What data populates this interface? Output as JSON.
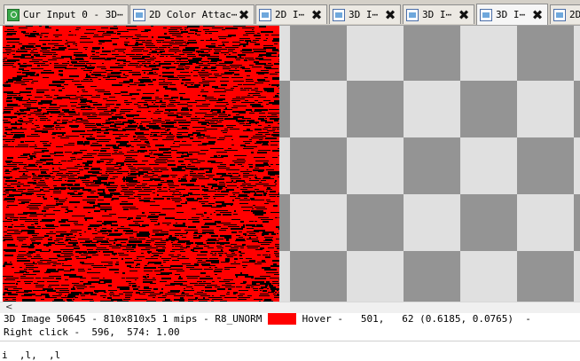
{
  "tabs": [
    {
      "label": "Cur Input 0 - 3D⋯",
      "icon": "texture-viewer-icon",
      "closable": false,
      "active": false
    },
    {
      "label": "2D Color Attac⋯",
      "icon": "document-icon",
      "closable": true,
      "active": false
    },
    {
      "label": "2D I⋯",
      "icon": "document-icon",
      "closable": true,
      "active": false
    },
    {
      "label": "3D I⋯",
      "icon": "document-icon",
      "closable": true,
      "active": false
    },
    {
      "label": "3D I⋯",
      "icon": "document-icon",
      "closable": true,
      "active": false
    },
    {
      "label": "3D I⋯",
      "icon": "document-icon",
      "closable": true,
      "active": true
    },
    {
      "label": "2D",
      "icon": "document-icon",
      "closable": false,
      "active": false
    }
  ],
  "close_glyph": "✖",
  "status": {
    "line1_prefix": "3D Image 50645 - 810x810x5 1 mips - R8_UNORM ",
    "swatch_color": "#ff0000",
    "line1_suffix": " Hover -   501,   62 (0.6185, 0.0765)  -",
    "line2": "Right click -  596,  574: 1.00"
  },
  "bottom_text": "i  ,l,  ,l",
  "colors": {
    "noise_base": "#ff0000",
    "noise_dark": "#000000",
    "checker_light": "#e0e0e0",
    "checker_dark": "#949494"
  },
  "scroll_arrow": "<"
}
